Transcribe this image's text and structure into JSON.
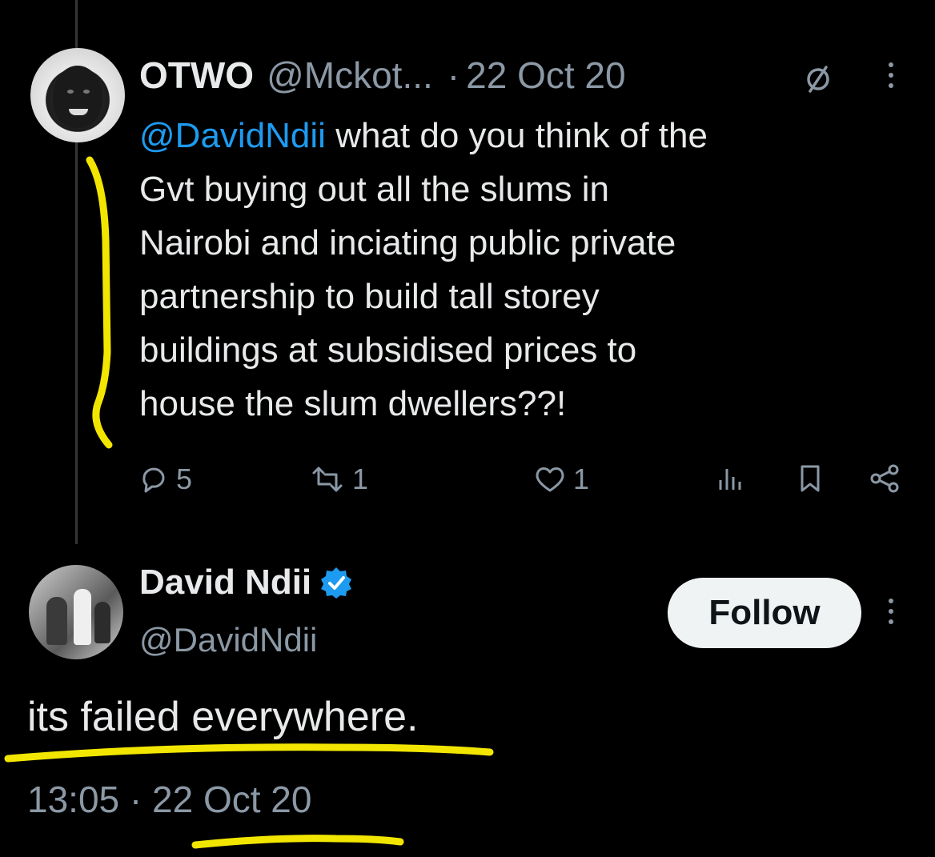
{
  "colors": {
    "background": "#000000",
    "text_primary": "#e7e9ea",
    "text_secondary": "#8b98a5",
    "link": "#1d9bf0",
    "verified": "#1d9bf0",
    "highlighter": "#f2e600",
    "follow_button_bg": "#eff3f4"
  },
  "parent_tweet": {
    "author_name": "OTWO",
    "handle": "@Mckot...",
    "separator": "·",
    "date": "22 Oct 20",
    "mention": "@DavidNdii",
    "text_lines": [
      " what do you think of the",
      "Gvt buying out all the slums in",
      "Nairobi and inciating public private",
      "partnership to build tall storey",
      "buildings at subsidised prices to",
      "house the slum dwellers??!"
    ],
    "icons": [
      "avatar",
      "grok-icon",
      "more-icon"
    ],
    "actions": {
      "replies": "5",
      "reposts": "1",
      "likes": "1"
    },
    "action_icons": [
      "reply-icon",
      "repost-icon",
      "like-icon",
      "views-icon",
      "bookmark-icon",
      "share-icon"
    ]
  },
  "reply_tweet": {
    "author_name": "David Ndii",
    "handle": "@DavidNdii",
    "follow_label": "Follow",
    "text": "its failed everywhere.",
    "time": "13:05",
    "separator": "·",
    "date": "22 Oct 20",
    "icons": [
      "avatar",
      "verified-badge-icon",
      "more-icon"
    ]
  }
}
